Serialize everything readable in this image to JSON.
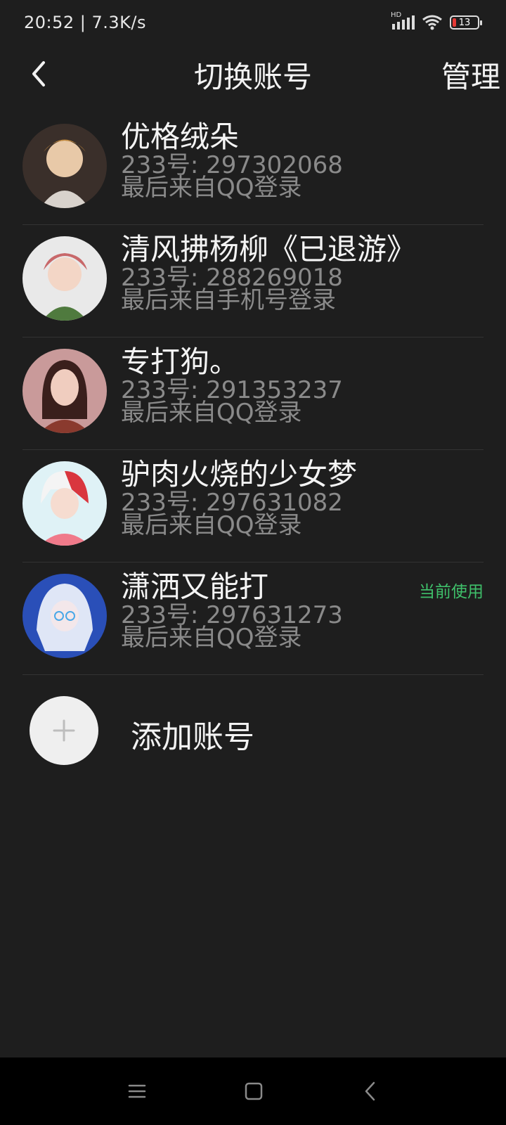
{
  "status_bar": {
    "time_speed": "20:52 | 7.3K/s",
    "network_badge": "HD",
    "battery_level": "13",
    "icons": [
      "signal-icon",
      "wifi-icon",
      "battery-icon"
    ]
  },
  "header": {
    "title": "切换账号",
    "manage_label": "管理"
  },
  "accounts": [
    {
      "name": "优格绒朵",
      "id_line": "233号: 297302068",
      "source_line": "最后来自QQ登录",
      "badge": ""
    },
    {
      "name": "清风拂杨柳《已退游》",
      "id_line": "233号: 288269018",
      "source_line": "最后来自手机号登录",
      "badge": ""
    },
    {
      "name": "专打狗。",
      "id_line": "233号: 291353237",
      "source_line": "最后来自QQ登录",
      "badge": ""
    },
    {
      "name": "驴肉火烧的少女梦",
      "id_line": "233号: 297631082",
      "source_line": "最后来自QQ登录",
      "badge": ""
    },
    {
      "name": "潇洒又能打",
      "id_line": "233号: 297631273",
      "source_line": "最后来自QQ登录",
      "badge": "当前使用"
    }
  ],
  "add_account": {
    "label": "添加账号"
  },
  "colors": {
    "background": "#1e1e1e",
    "current_badge": "#3fbf6a",
    "secondary_text": "#8a8a8a"
  }
}
